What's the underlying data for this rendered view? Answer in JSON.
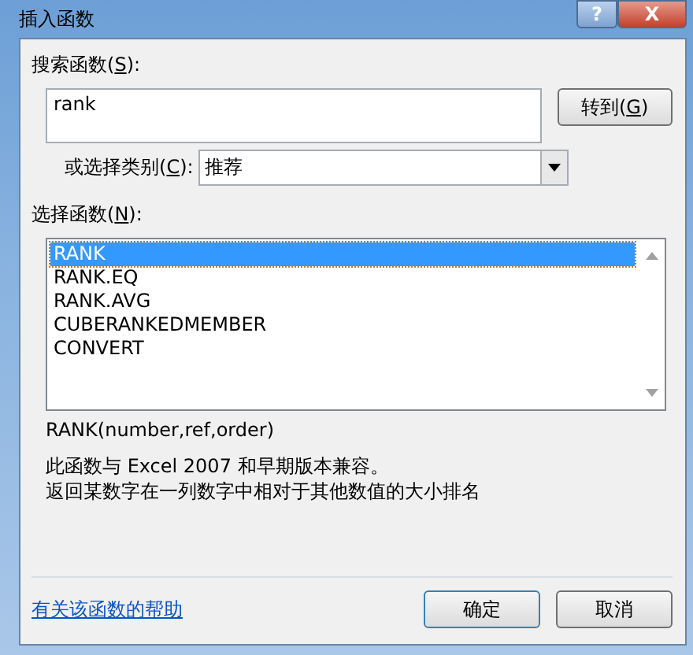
{
  "window": {
    "title": "插入函数",
    "help_button": "?",
    "close_button": "X"
  },
  "search": {
    "label": {
      "before": "搜索函数(",
      "key": "S",
      "after": "):"
    },
    "value": "rank",
    "go_button": {
      "before": "转到(",
      "key": "G",
      "after": ")"
    }
  },
  "category": {
    "label": {
      "before": "或选择类别(",
      "key": "C",
      "after": "):"
    },
    "value": "推荐"
  },
  "functions": {
    "label": {
      "before": "选择函数(",
      "key": "N",
      "after": "):"
    },
    "items": [
      {
        "name": "RANK",
        "selected": true
      },
      {
        "name": "RANK.EQ",
        "selected": false
      },
      {
        "name": "RANK.AVG",
        "selected": false
      },
      {
        "name": "CUBERANKEDMEMBER",
        "selected": false
      },
      {
        "name": "CONVERT",
        "selected": false
      }
    ]
  },
  "signature": "RANK(number,ref,order)",
  "description": [
    "此函数与 Excel 2007 和早期版本兼容。",
    "返回某数字在一列数字中相对于其他数值的大小排名"
  ],
  "help_link": "有关该函数的帮助",
  "buttons": [
    "确定",
    "取消"
  ]
}
